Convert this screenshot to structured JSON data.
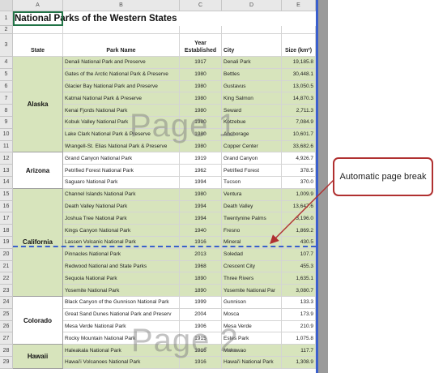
{
  "columns": [
    "A",
    "B",
    "C",
    "D",
    "E"
  ],
  "title": "National Parks of the Western States",
  "headers": {
    "state": "State",
    "park_name": "Park Name",
    "year": "Year Established",
    "city": "City",
    "size": "Size (km²)"
  },
  "rows": [
    {
      "n": "1"
    },
    {
      "n": "2"
    },
    {
      "n": "3"
    },
    {
      "n": "4",
      "park": "Denali National Park and Preserve",
      "year": "1917",
      "city": "Denali Park",
      "size": "19,185.8"
    },
    {
      "n": "5",
      "park": "Gates of the Arctic National Park & Preserve",
      "year": "1980",
      "city": "Bettles",
      "size": "30,448.1"
    },
    {
      "n": "6",
      "park": "Glacier Bay National Park and Preserve",
      "year": "1980",
      "city": "Gustavus",
      "size": "13,050.5"
    },
    {
      "n": "7",
      "park": "Katmai National Park & Preserve",
      "year": "1980",
      "city": "King Salmon",
      "size": "14,870.3"
    },
    {
      "n": "8",
      "park": "Kenai Fjords National Park",
      "year": "1980",
      "city": "Seward",
      "size": "2,711.3"
    },
    {
      "n": "9",
      "park": "Kobuk Valley National Park",
      "year": "1980",
      "city": "Kotzebue",
      "size": "7,084.9"
    },
    {
      "n": "10",
      "park": "Lake Clark National Park & Preserve",
      "year": "1980",
      "city": "Anchorage",
      "size": "10,601.7"
    },
    {
      "n": "11",
      "park": "Wrangell-St. Elias National Park & Preserve",
      "year": "1980",
      "city": "Copper Center",
      "size": "33,682.6"
    },
    {
      "n": "12",
      "park": "Grand Canyon National Park",
      "year": "1919",
      "city": "Grand Canyon",
      "size": "4,926.7"
    },
    {
      "n": "13",
      "park": "Petrified Forest National Park",
      "year": "1962",
      "city": "Petrified Forest",
      "size": "378.5"
    },
    {
      "n": "14",
      "park": "Saguaro National Park",
      "year": "1994",
      "city": "Tucson",
      "size": "370.0"
    },
    {
      "n": "15",
      "park": "Channel Islands National Park",
      "year": "1980",
      "city": "Ventura",
      "size": "1,009.9"
    },
    {
      "n": "16",
      "park": "Death Valley National Park",
      "year": "1994",
      "city": "Death Valley",
      "size": "13,647.6"
    },
    {
      "n": "17",
      "park": "Joshua Tree National Park",
      "year": "1994",
      "city": "Twentynine Palms",
      "size": "3,196.0"
    },
    {
      "n": "18",
      "park": "Kings Canyon National Park",
      "year": "1940",
      "city": "Fresno",
      "size": "1,869.2"
    },
    {
      "n": "19",
      "park": "Lassen Volcanic National Park",
      "year": "1916",
      "city": "Mineral",
      "size": "430.5"
    },
    {
      "n": "20",
      "park": "Pinnacles National Park",
      "year": "2013",
      "city": "Soledad",
      "size": "107.7"
    },
    {
      "n": "21",
      "park": "Redwood National and State Parks",
      "year": "1968",
      "city": "Crescent City",
      "size": "455.3"
    },
    {
      "n": "22",
      "park": "Sequoia National Park",
      "year": "1890",
      "city": "Three Rivers",
      "size": "1,635.1"
    },
    {
      "n": "23",
      "park": "Yosemite National Park",
      "year": "1890",
      "city": "Yosemite National Par",
      "size": "3,080.7"
    },
    {
      "n": "24",
      "park": "Black Canyon of the Gunnison National Park",
      "year": "1999",
      "city": "Gunnison",
      "size": "133.3"
    },
    {
      "n": "25",
      "park": "Great Sand Dunes National Park and Preserv",
      "year": "2004",
      "city": "Mosca",
      "size": "173.9"
    },
    {
      "n": "26",
      "park": "Mesa Verde National Park",
      "year": "1906",
      "city": "Mesa Verde",
      "size": "210.9"
    },
    {
      "n": "27",
      "park": "Rocky Mountain National Park",
      "year": "1915",
      "city": "Estes Park",
      "size": "1,075.8"
    },
    {
      "n": "28",
      "park": "Haleakala National Park",
      "year": "1916",
      "city": "Makawao",
      "size": "117.7"
    },
    {
      "n": "29",
      "park": "Hawai'i Volcanoes National Park",
      "year": "1916",
      "city": "Hawai'i National Park",
      "size": "1,308.9"
    }
  ],
  "states": [
    {
      "name": "Alaska",
      "first_row": 4,
      "last_row": 11,
      "green": true
    },
    {
      "name": "Arizona",
      "first_row": 12,
      "last_row": 14,
      "green": false
    },
    {
      "name": "California",
      "first_row": 15,
      "last_row": 23,
      "green": true
    },
    {
      "name": "Colorado",
      "first_row": 24,
      "last_row": 27,
      "green": false
    },
    {
      "name": "Hawaii",
      "first_row": 28,
      "last_row": 29,
      "green": true
    }
  ],
  "watermarks": {
    "page1": "Page 1",
    "page2": "Page 2"
  },
  "callout": {
    "text": "Automatic page break",
    "border_color": "#b03030"
  },
  "colors": {
    "accent_green": "#d7e4bc",
    "page_break_blue": "#3a5fcd",
    "selection": "#217346"
  }
}
